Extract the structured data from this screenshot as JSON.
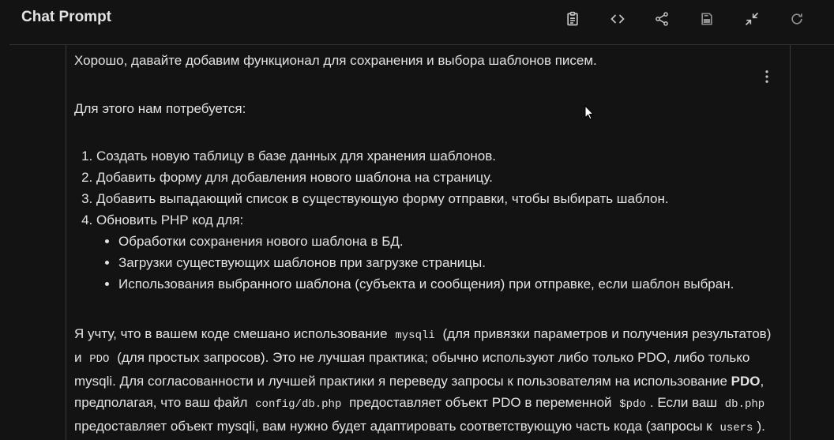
{
  "header": {
    "title": "Chat Prompt",
    "icons": [
      "clipboard-icon",
      "code-icon",
      "share-icon",
      "save-icon",
      "collapse-icon",
      "refresh-icon"
    ]
  },
  "message": {
    "intro": "Хорошо, давайте добавим функционал для сохранения и выбора шаблонов писем.",
    "need": "Для этого нам потребуется:",
    "steps": [
      "Создать новую таблицу в базе данных для хранения шаблонов.",
      "Добавить форму для добавления нового шаблона на страницу.",
      "Добавить выпадающий список в существующую форму отправки, чтобы выбирать шаблон.",
      "Обновить PHP код для:"
    ],
    "substeps": [
      "Обработки сохранения нового шаблона в БД.",
      "Загрузки существующих шаблонов при загрузке страницы.",
      "Использования выбранного шаблона (субъекта и сообщения) при отправке, если шаблон выбран."
    ],
    "para_1": "Я учту, что в вашем коде смешано использование",
    "code_mysqli": "mysqli",
    "para_2": "(для привязки параметров и получения результатов) и",
    "code_pdo": "PDO",
    "para_3": "(для простых запросов). Это не лучшая практика; обычно используют либо только PDO, либо только mysqli. Для согласованности и лучшей практики я переведу запросы к пользователям на использование",
    "bold_pdo": "PDO",
    "para_4": ", предполагая, что ваш файл",
    "code_config": "config/db.php",
    "para_5": "предоставляет объект PDO в переменной",
    "code_var": "$pdo",
    "para_6": ". Если ваш",
    "code_dbphp": "db.php",
    "para_7": "предоставляет объект mysqli, вам нужно будет адаптировать соответствующую часть кода (запросы к",
    "code_users": "users",
    "para_8": ")."
  },
  "colors": {
    "background": "#131314",
    "text": "#e3e3e3",
    "border": "#3a3b3e"
  }
}
